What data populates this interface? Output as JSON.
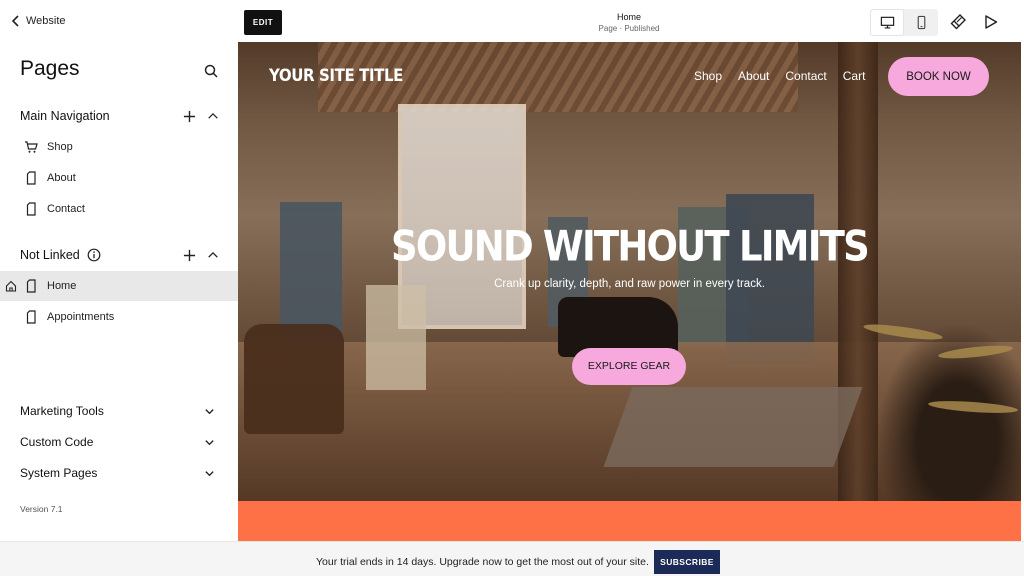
{
  "sidebar": {
    "back_label": "Website",
    "title": "Pages",
    "main_nav": {
      "label": "Main Navigation",
      "items": [
        {
          "label": "Shop",
          "icon": "cart-icon"
        },
        {
          "label": "About",
          "icon": "page-icon"
        },
        {
          "label": "Contact",
          "icon": "page-icon"
        }
      ]
    },
    "not_linked": {
      "label": "Not Linked",
      "items": [
        {
          "label": "Home",
          "icon": "page-icon",
          "active": true
        },
        {
          "label": "Appointments",
          "icon": "page-icon"
        }
      ]
    },
    "sections": [
      "Marketing Tools",
      "Custom Code",
      "System Pages"
    ],
    "version": "Version 7.1"
  },
  "editor": {
    "edit_label": "EDIT",
    "page_title": "Home",
    "page_status": "Page · Published"
  },
  "site": {
    "title": "YOUR SITE TITLE",
    "nav": [
      "Shop",
      "About",
      "Contact",
      "Cart"
    ],
    "cta": "BOOK NOW",
    "hero_heading": "SOUND WITHOUT LIMITS",
    "hero_sub": "Crank up clarity, depth, and raw power in every track.",
    "hero_button": "EXPLORE GEAR",
    "accent_color": "#f7a8dc",
    "strip_color": "#fe7146"
  },
  "trial": {
    "text": "Your trial ends in 14 days. Upgrade now to get the most out of your site.",
    "button": "SUBSCRIBE"
  }
}
